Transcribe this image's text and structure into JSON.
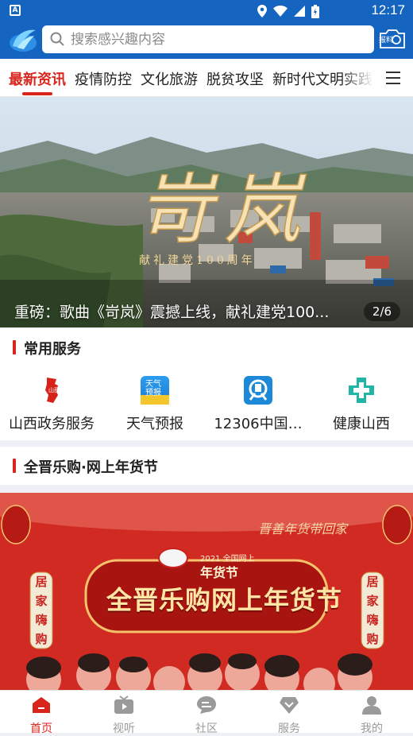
{
  "status_bar": {
    "time": "12:17"
  },
  "header": {
    "search_placeholder": "搜索感兴趣内容",
    "report_label": "报料"
  },
  "tabs": [
    {
      "label": "最新资讯",
      "active": true
    },
    {
      "label": "疫情防控"
    },
    {
      "label": "文化旅游"
    },
    {
      "label": "脱贫攻坚"
    },
    {
      "label": "新时代文明实践"
    }
  ],
  "banner": {
    "title_art": "岢岚",
    "subtitle_art": "献礼建党100周年",
    "caption": "重磅：歌曲《岢岚》震撼上线，献礼建党100...",
    "pager": "2/6"
  },
  "services": {
    "title": "常用服务",
    "items": [
      {
        "label": "山西政务服务",
        "icon": "shanxi-gov-icon"
      },
      {
        "label": "天气预报",
        "icon": "weather-icon",
        "badge": "天气 预报"
      },
      {
        "label": "12306中国…",
        "icon": "railway-icon"
      },
      {
        "label": "健康山西",
        "icon": "health-cross-icon"
      }
    ]
  },
  "promo": {
    "title": "全晋乐购·网上年货节",
    "calligraphy": "晋善年货带回家",
    "badge_year": "2021 全国网上",
    "badge_text": "年货节",
    "headline": "全晋乐购网上年货节",
    "left_scroll": [
      "居",
      "家",
      "嗨",
      "购"
    ],
    "right_scroll": [
      "居",
      "家",
      "嗨",
      "购"
    ]
  },
  "bottom_nav": [
    {
      "label": "首页",
      "icon": "home-icon",
      "active": true
    },
    {
      "label": "视听",
      "icon": "tv-icon"
    },
    {
      "label": "社区",
      "icon": "chat-icon"
    },
    {
      "label": "服务",
      "icon": "service-icon"
    },
    {
      "label": "我的",
      "icon": "profile-icon"
    }
  ],
  "colors": {
    "brand_blue": "#1565c0",
    "accent_red": "#d8261d",
    "promo_red": "#c8231e"
  }
}
